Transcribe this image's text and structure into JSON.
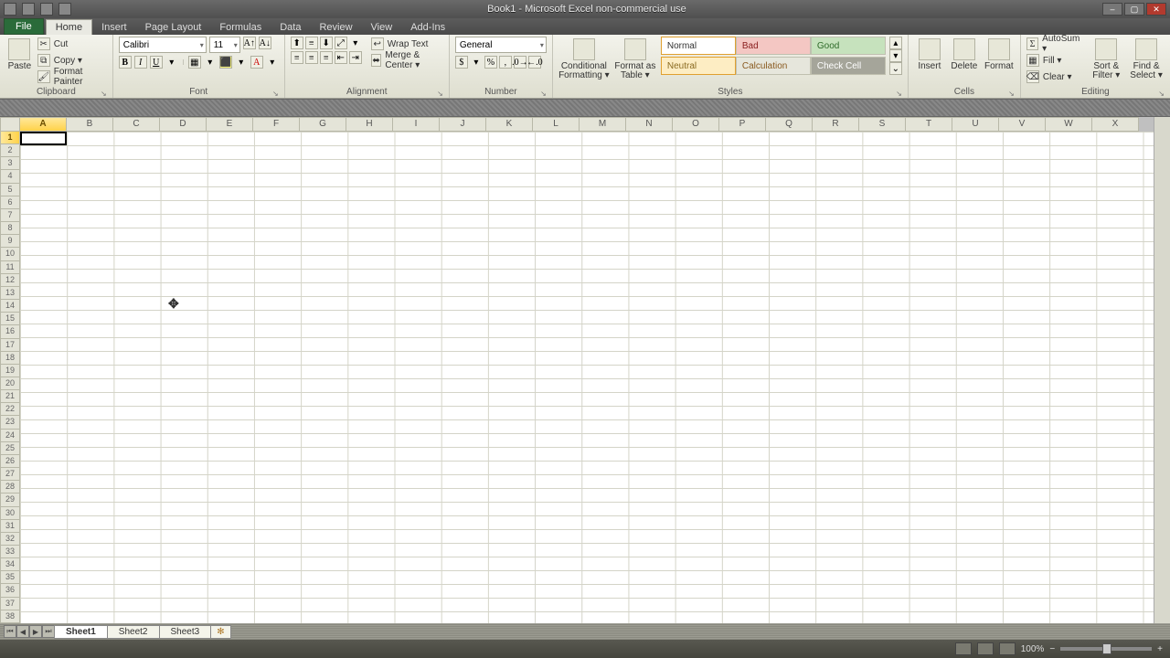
{
  "title": "Book1 - Microsoft Excel non-commercial use",
  "tabs": {
    "file": "File",
    "list": [
      "Home",
      "Insert",
      "Page Layout",
      "Formulas",
      "Data",
      "Review",
      "View",
      "Add-Ins"
    ],
    "active": "Home"
  },
  "clipboard": {
    "paste": "Paste",
    "cut": "Cut",
    "copy": "Copy ▾",
    "painter": "Format Painter",
    "label": "Clipboard"
  },
  "font": {
    "name": "Calibri",
    "size": "11",
    "label": "Font"
  },
  "alignment": {
    "wrap": "Wrap Text",
    "merge": "Merge & Center ▾",
    "label": "Alignment"
  },
  "number": {
    "format": "General",
    "label": "Number"
  },
  "styles": {
    "condfmt": "Conditional Formatting ▾",
    "astable": "Format as Table ▾",
    "cells": {
      "normal": "Normal",
      "bad": "Bad",
      "good": "Good",
      "neutral": "Neutral",
      "calc": "Calculation",
      "check": "Check Cell"
    },
    "label": "Styles"
  },
  "cellsgrp": {
    "insert": "Insert",
    "delete": "Delete",
    "format": "Format",
    "label": "Cells"
  },
  "editing": {
    "autosum": "AutoSum ▾",
    "fill": "Fill ▾",
    "clear": "Clear ▾",
    "sort": "Sort & Filter ▾",
    "find": "Find & Select ▾",
    "label": "Editing"
  },
  "grid": {
    "active_col": "A",
    "active_row": "1",
    "cols": [
      "A",
      "B",
      "C",
      "D",
      "E",
      "F",
      "G",
      "H",
      "I",
      "J",
      "K",
      "L",
      "M",
      "N",
      "O",
      "P",
      "Q",
      "R",
      "S",
      "T",
      "U",
      "V",
      "W",
      "X"
    ]
  },
  "sheets": {
    "list": [
      "Sheet1",
      "Sheet2",
      "Sheet3"
    ],
    "active": "Sheet1"
  },
  "zoom": "100%"
}
